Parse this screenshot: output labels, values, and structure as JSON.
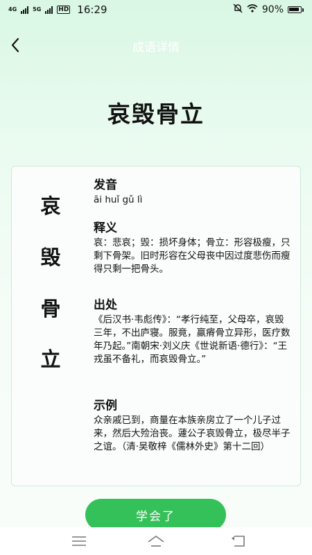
{
  "status_bar": {
    "network_1": "4G",
    "network_2": "5G",
    "hd_badge": "HD",
    "time": "16:29",
    "battery_text": "90%",
    "battery_level": 0.9,
    "icons": [
      "signal-icon",
      "mute-icon",
      "wifi-icon",
      "battery-icon"
    ]
  },
  "header": {
    "title": "成语详情",
    "back_icon": "chevron-left-icon",
    "title_color": "#ffffff"
  },
  "idiom": {
    "word": "哀毁骨立",
    "chars": [
      "哀",
      "毁",
      "骨",
      "立"
    ]
  },
  "sections": {
    "pronunciation": {
      "heading": "发音",
      "text": "āi huǐ gǔ lì"
    },
    "meaning": {
      "heading": "释义",
      "text": "哀：悲哀；毁：损坏身体；骨立：形容极瘦，只剩下骨架。旧时形容在父母丧中因过度悲伤而瘦得只剩一把骨头。"
    },
    "source": {
      "heading": "出处",
      "text": "《后汉书·韦彪传》：“孝行纯至，父母卒，哀毁三年，不出庐寝。服竟，羸瘠骨立异形，医疗数年乃起。”南朝宋·刘义庆《世说新语·德行》：“王戎虽不备礼，而哀毁骨立。”"
    },
    "example": {
      "heading": "示例",
      "text": "众亲戚已到，商量在本族亲房立了一个儿子过来，然后大殓治丧。蘧公子哀毁骨立，极尽半子之谊。（清·吴敬梓《儒林外史》第十二回）"
    }
  },
  "actions": {
    "learned_label": "学会了"
  },
  "colors": {
    "accent": "#34c159",
    "card_border": "#cfe8d8"
  },
  "system_nav": {
    "icons": [
      "menu-icon",
      "home-icon",
      "back-icon"
    ]
  }
}
